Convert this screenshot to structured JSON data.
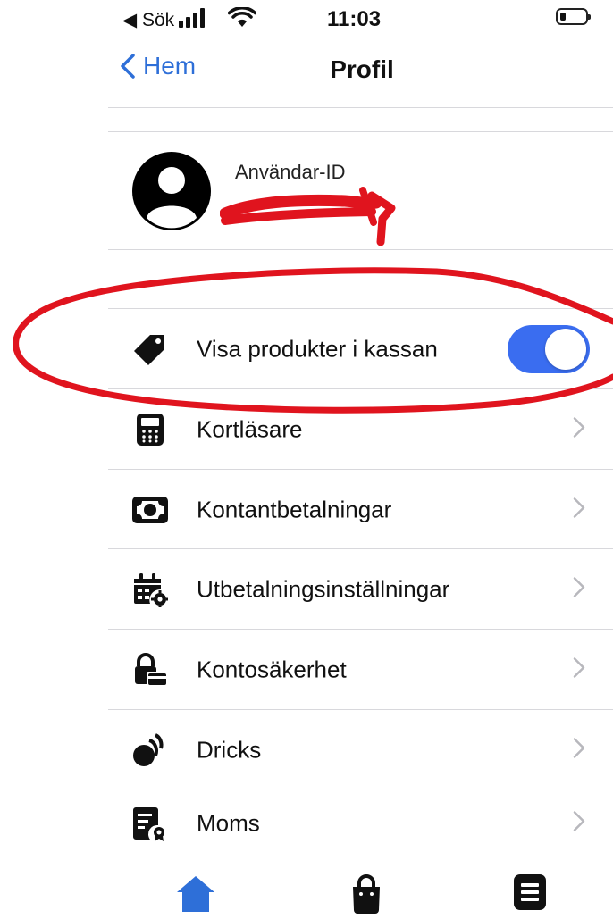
{
  "status_bar": {
    "back_app": "◀ Sök",
    "time": "11:03"
  },
  "nav": {
    "back_label": "Hem",
    "title": "Profil"
  },
  "profile": {
    "user_id_label": "Användar-ID"
  },
  "rows": [
    {
      "label": "Visa produkter i kassan",
      "icon": "tag-icon",
      "control": "toggle",
      "toggle_on": true
    },
    {
      "label": "Kortläsare",
      "icon": "card-reader-icon",
      "control": "chevron"
    },
    {
      "label": "Kontantbetalningar",
      "icon": "cash-icon",
      "control": "chevron"
    },
    {
      "label": "Utbetalningsinställningar",
      "icon": "calendar-gear-icon",
      "control": "chevron"
    },
    {
      "label": "Kontosäkerhet",
      "icon": "lock-card-icon",
      "control": "chevron"
    },
    {
      "label": "Dricks",
      "icon": "coins-icon",
      "control": "chevron"
    },
    {
      "label": "Moms",
      "icon": "tax-document-icon",
      "control": "chevron"
    }
  ],
  "tab_bar": {
    "tabs": [
      {
        "icon": "home-icon",
        "active": true
      },
      {
        "icon": "shopping-bag-icon",
        "active": false
      },
      {
        "icon": "list-icon",
        "active": false
      }
    ]
  },
  "colors": {
    "accent": "#2e6fd8",
    "toggle_on": "#3a6df0",
    "annotation_red": "#e0141e",
    "divider": "#d8d8dc"
  }
}
